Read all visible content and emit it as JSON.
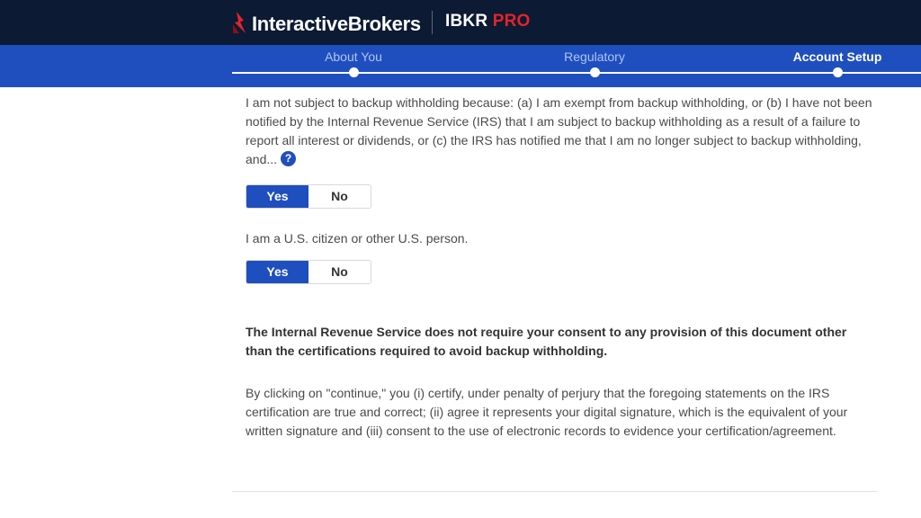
{
  "header": {
    "brand_name": "InteractiveBrokers",
    "product_main": "IBKR",
    "product_suffix": "PRO"
  },
  "steps": [
    {
      "label": "About You",
      "active": false
    },
    {
      "label": "Regulatory",
      "active": false
    },
    {
      "label": "Account Setup",
      "active": true
    }
  ],
  "backup_withholding": {
    "text": "I am not subject to backup withholding because: (a) I am exempt from backup withholding, or (b) I have not been notified by the Internal Revenue Service (IRS) that I am subject to backup withholding as a result of a failure to report all interest or dividends, or (c) the IRS has notified me that I am no longer subject to backup withholding, and...",
    "help_icon": "?",
    "yes_label": "Yes",
    "no_label": "No",
    "selected": "Yes"
  },
  "us_person": {
    "text": "I am a U.S. citizen or other U.S. person.",
    "yes_label": "Yes",
    "no_label": "No",
    "selected": "Yes"
  },
  "irs_notice": "The Internal Revenue Service does not require your consent to any provision of this document other than the certifications required to avoid backup withholding.",
  "consent_text": "By clicking on \"continue,\" you (i) certify, under penalty of perjury that the foregoing statements on the IRS certification are true and correct; (ii) agree it represents your digital signature, which is the equivalent of your written signature and (iii) consent to the use of electronic records to evidence your certification/agreement.",
  "colors": {
    "header_bg": "#0c1a33",
    "stepbar_bg": "#1f4fbf",
    "accent_red": "#e2242b",
    "selected_button": "#1f4fbf"
  }
}
